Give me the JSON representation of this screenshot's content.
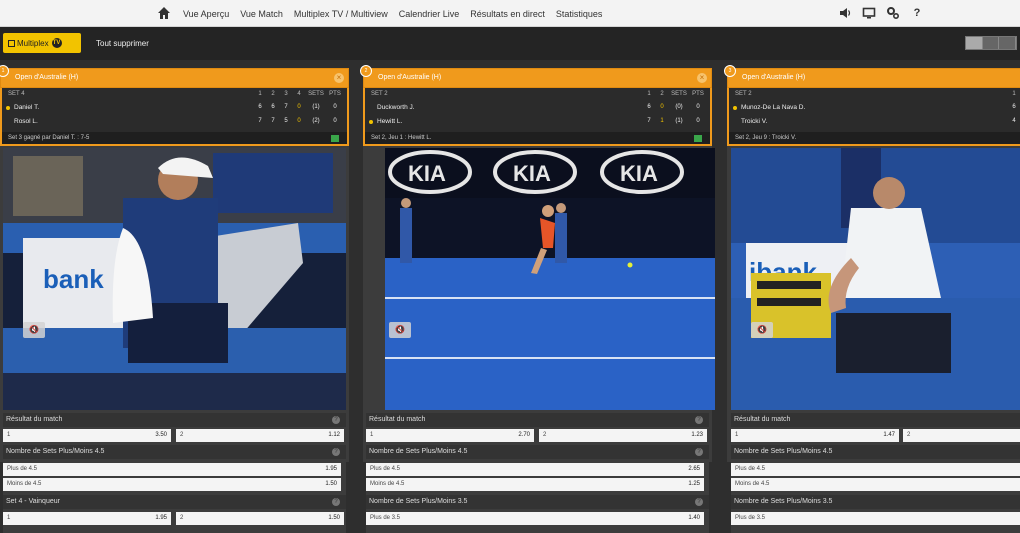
{
  "nav": {
    "links": [
      "Vue Aperçu",
      "Vue Match",
      "Multiplex TV / Multiview",
      "Calendrier Live",
      "Résultats en direct",
      "Statistiques"
    ],
    "icons": [
      "sound-icon",
      "tv-icon",
      "settings-icon",
      "help-icon"
    ],
    "help_label": "?"
  },
  "toolbar": {
    "multiplex_label": "Multiplex",
    "tv_badge": "TV",
    "clear_label": "Tout supprimer"
  },
  "colors": {
    "accent": "#f09a1c",
    "highlight": "#f2c300"
  },
  "panels": [
    {
      "num": "1",
      "tournament": "Open d'Australie (H)",
      "close": "×",
      "header": {
        "set": "SET 4",
        "cols": [
          "1",
          "2",
          "3",
          "4",
          "SETS",
          "PTS"
        ]
      },
      "players": [
        {
          "name": "Daniel T.",
          "scores": [
            "6",
            "6",
            "7",
            "0",
            "(1)",
            "0"
          ]
        },
        {
          "name": "Rosol L.",
          "scores": [
            "7",
            "7",
            "5",
            "0",
            "(2)",
            "0"
          ]
        }
      ],
      "status": "Set 3 gagné par Daniel T. : 7-5",
      "mute": "🔇",
      "markets": [
        {
          "title": "Résultat du match",
          "help": "?",
          "rows": [
            [
              {
                "label": "1",
                "odd": "3.50"
              },
              {
                "label": "2",
                "odd": "1.12"
              }
            ]
          ]
        },
        {
          "title": "Nombre de Sets Plus/Moins 4.5",
          "help": "?",
          "rows": [
            [
              {
                "label": "Plus de 4.5",
                "odd": "1.95"
              }
            ],
            [
              {
                "label": "Moins de 4.5",
                "odd": "1.50"
              }
            ]
          ]
        },
        {
          "title": "Set 4 - Vainqueur",
          "help": "?",
          "rows": [
            [
              {
                "label": "1",
                "odd": "1.95"
              },
              {
                "label": "2",
                "odd": "1.50"
              }
            ]
          ]
        }
      ]
    },
    {
      "num": "2",
      "tournament": "Open d'Australie (H)",
      "close": "×",
      "header": {
        "set": "SET 2",
        "cols": [
          "1",
          "2",
          "SETS",
          "PTS"
        ]
      },
      "players": [
        {
          "name": "Duckworth J.",
          "scores": [
            "6",
            "0",
            "(0)",
            "0"
          ]
        },
        {
          "name": "Hewitt L.",
          "scores": [
            "7",
            "1",
            "(1)",
            "0"
          ]
        }
      ],
      "status": "Set 2, Jeu 1 : Hewitt L.",
      "mute": "🔇",
      "video_text": [
        "KIA",
        "KIA",
        "KIA"
      ],
      "markets": [
        {
          "title": "Résultat du match",
          "help": "?",
          "rows": [
            [
              {
                "label": "1",
                "odd": "2.70"
              },
              {
                "label": "2",
                "odd": "1.23"
              }
            ]
          ]
        },
        {
          "title": "Nombre de Sets Plus/Moins 4.5",
          "help": "?",
          "rows": [
            [
              {
                "label": "Plus de 4.5",
                "odd": "2.65"
              }
            ],
            [
              {
                "label": "Moins de 4.5",
                "odd": "1.25"
              }
            ]
          ]
        },
        {
          "title": "Nombre de Sets Plus/Moins 3.5",
          "help": "?",
          "rows": [
            [
              {
                "label": "Plus de 3.5",
                "odd": "1.40"
              }
            ]
          ]
        }
      ]
    },
    {
      "num": "3",
      "tournament": "Open d'Australie (H)",
      "header": {
        "set": "SET 2",
        "cols": [
          "1"
        ]
      },
      "players": [
        {
          "name": "Munoz-De La Nava D.",
          "scores": [
            "6"
          ]
        },
        {
          "name": "Troicki V.",
          "scores": [
            "4"
          ]
        }
      ],
      "status": "Set 2, Jeu 9 : Troicki V.",
      "mute": "🔇",
      "markets": [
        {
          "title": "Résultat du match",
          "help": "",
          "rows": [
            [
              {
                "label": "1",
                "odd": "1.47"
              },
              {
                "label": "2",
                "odd": ""
              }
            ]
          ]
        },
        {
          "title": "Nombre de Sets Plus/Moins 4.5",
          "help": "",
          "rows": [
            [
              {
                "label": "Plus de 4.5",
                "odd": ""
              }
            ],
            [
              {
                "label": "Moins de 4.5",
                "odd": ""
              }
            ]
          ]
        },
        {
          "title": "Nombre de Sets Plus/Moins 3.5",
          "help": "",
          "rows": [
            [
              {
                "label": "Plus de 3.5",
                "odd": ""
              }
            ]
          ]
        }
      ]
    }
  ]
}
